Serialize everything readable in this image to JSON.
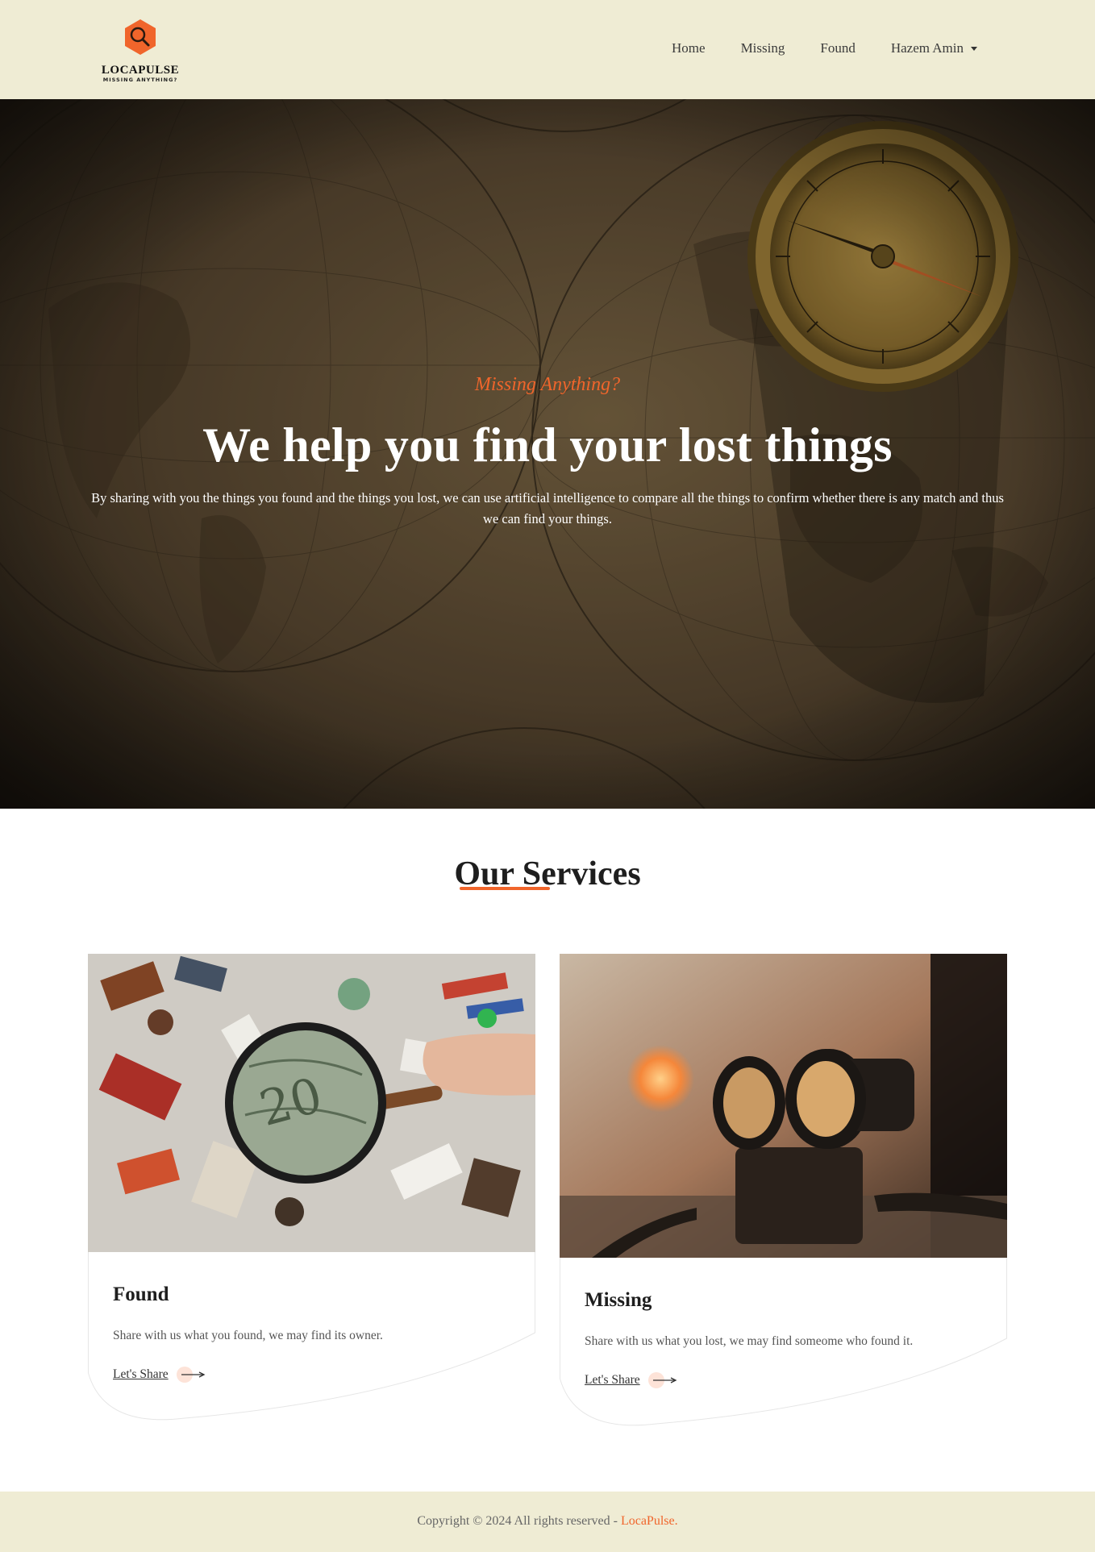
{
  "header": {
    "logo": {
      "name": "LOCAPULSE",
      "tagline": "MISSING ANYTHING?",
      "icon": "magnifier-icon"
    },
    "nav": [
      {
        "label": "Home"
      },
      {
        "label": "Missing"
      },
      {
        "label": "Found"
      },
      {
        "label": "Hazem Amin",
        "icon": "caret-down-icon"
      }
    ]
  },
  "hero": {
    "subtitle": "Missing Anything?",
    "title": "We help you find your lost things",
    "description": "By sharing with you the things you found and the things you lost, we can use artificial intelligence to compare all the things to confirm whether there is any match and thus we can find your things."
  },
  "services": {
    "title": "Our Services",
    "cards": [
      {
        "title": "Found",
        "text": "Share with us what you found, we may find its owner.",
        "link": "Let's Share"
      },
      {
        "title": "Missing",
        "text": "Share with us what you lost, we may find someome who found it.",
        "link": "Let's Share"
      }
    ]
  },
  "footer": {
    "text": "Copyright © 2024 All rights reserved - ",
    "brand": "LocaPulse."
  },
  "colors": {
    "accent": "#f0652b",
    "header_bg": "#efecd4",
    "footer_bg": "#efecd4"
  }
}
